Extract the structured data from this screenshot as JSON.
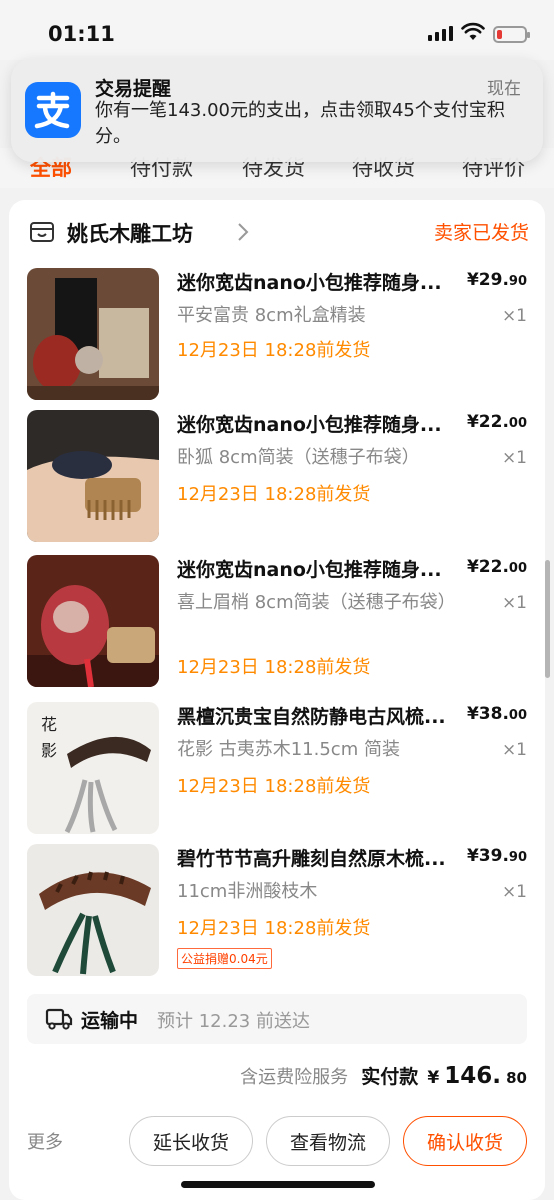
{
  "status_bar": {
    "time": "01:11"
  },
  "tabs": [
    {
      "label": "全部"
    },
    {
      "label": "待付款"
    },
    {
      "label": "待发货"
    },
    {
      "label": "待收货"
    },
    {
      "label": "待评价"
    }
  ],
  "notification": {
    "app_icon": "alipay-icon",
    "title": "交易提醒",
    "time": "现在",
    "body": "你有一笔143.00元的支出，点击领取45个支付宝积分。"
  },
  "order": {
    "shop_name": "姚氏木雕工坊",
    "status": "卖家已发货",
    "items": [
      {
        "title": "迷你宽齿nano小包推荐随身...",
        "price_int": "¥29.",
        "price_dec": "90",
        "sku": "平安富贵 8cm礼盒精装",
        "qty": "×1",
        "ship": "12月23日 18:28前发货"
      },
      {
        "title": "迷你宽齿nano小包推荐随身...",
        "price_int": "¥22.",
        "price_dec": "00",
        "sku": "卧狐 8cm简装（送穗子布袋）",
        "qty": "×1",
        "ship": "12月23日 18:28前发货"
      },
      {
        "title": "迷你宽齿nano小包推荐随身...",
        "price_int": "¥22.",
        "price_dec": "00",
        "sku": "喜上眉梢 8cm简装（送穗子布袋）",
        "qty": "×1",
        "ship": "12月23日 18:28前发货"
      },
      {
        "title": "黑檀沉贵宝自然防静电古风梳...",
        "price_int": "¥38.",
        "price_dec": "00",
        "sku": "花影 古夷苏木11.5cm 简装",
        "qty": "×1",
        "ship": "12月23日 18:28前发货"
      },
      {
        "title": "碧竹节节高升雕刻自然原木梳...",
        "price_int": "¥39.",
        "price_dec": "90",
        "sku": "11cm非洲酸枝木",
        "qty": "×1",
        "ship": "12月23日 18:28前发货",
        "badge": "公益捐赠0.04元"
      }
    ],
    "transit": {
      "label": "运输中",
      "eta": "预计 12.23 前送达"
    },
    "total": {
      "service": "含运费险服务",
      "label": "实付款",
      "currency": "¥",
      "amount": "146.",
      "amount_dec": "80"
    },
    "actions": {
      "more": "更多",
      "extend": "延长收货",
      "logistics": "查看物流",
      "confirm": "确认收货"
    }
  },
  "colors": {
    "accent": "#ff5000",
    "ship_date": "#ff8a00",
    "alipay": "#1677ff"
  }
}
